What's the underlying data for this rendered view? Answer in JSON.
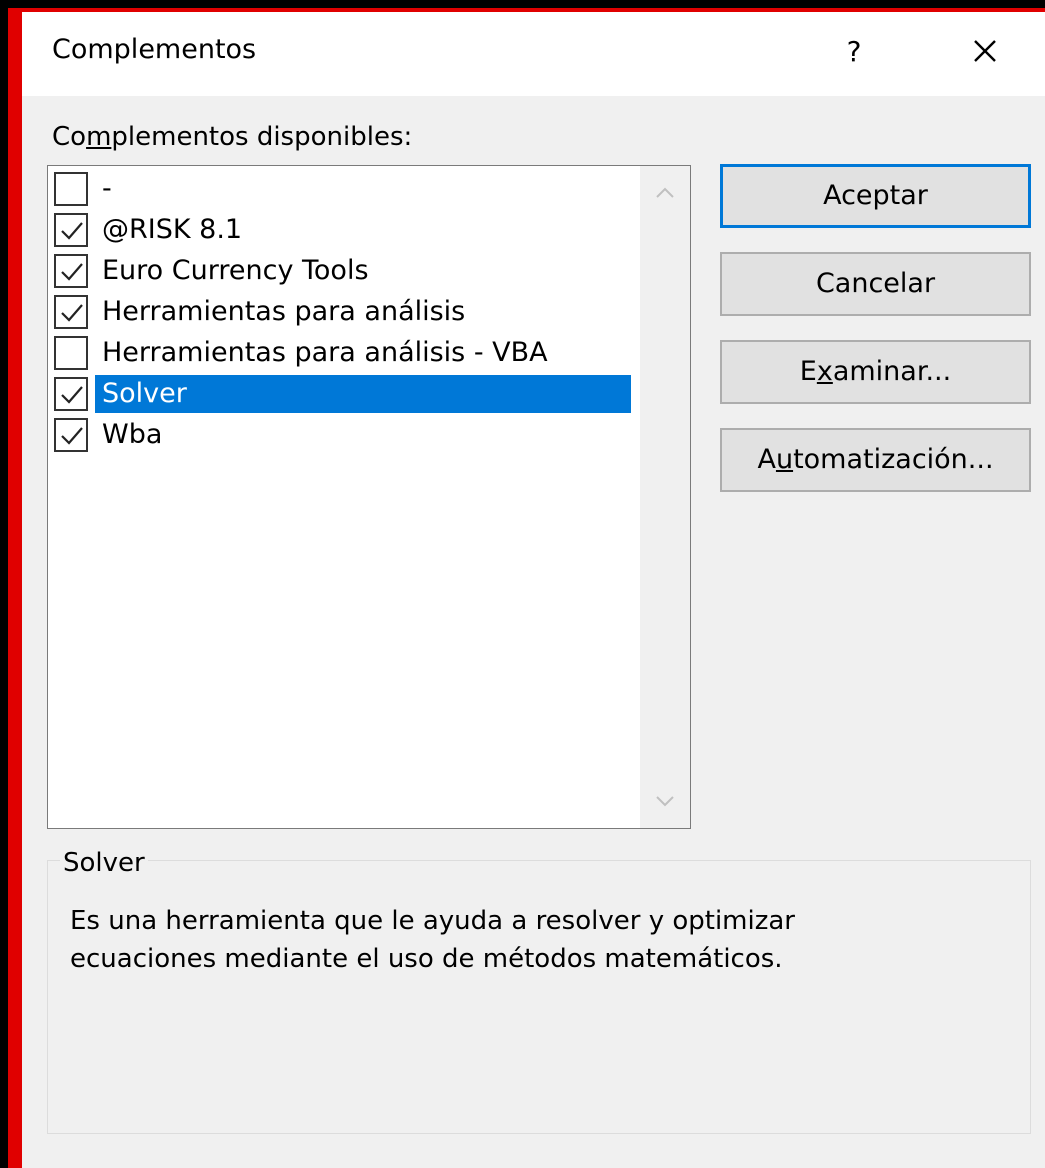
{
  "dialog": {
    "title": "Complementos",
    "help_label": "?",
    "close_icon": "close-icon"
  },
  "available": {
    "label_prefix": "Co",
    "label_underlined": "m",
    "label_suffix": "plementos disponibles:"
  },
  "addins": [
    {
      "label": "-",
      "checked": false,
      "selected": false
    },
    {
      "label": "@RISK 8.1",
      "checked": true,
      "selected": false
    },
    {
      "label": "Euro Currency Tools",
      "checked": true,
      "selected": false
    },
    {
      "label": "Herramientas para análisis",
      "checked": true,
      "selected": false
    },
    {
      "label": "Herramientas para análisis - VBA",
      "checked": false,
      "selected": false
    },
    {
      "label": "Solver",
      "checked": true,
      "selected": true
    },
    {
      "label": "Wba",
      "checked": true,
      "selected": false
    }
  ],
  "buttons": {
    "accept": "Aceptar",
    "cancel": "Cancelar",
    "browse_prefix": "E",
    "browse_underlined": "x",
    "browse_suffix": "aminar...",
    "automation_prefix": "A",
    "automation_underlined": "u",
    "automation_suffix": "tomatización..."
  },
  "details": {
    "title": "Solver",
    "description_line1": "Es una herramienta que le ayuda a resolver y optimizar",
    "description_line2": "ecuaciones mediante el uso de métodos matemáticos."
  },
  "colors": {
    "selection": "#0078d7",
    "frame_border": "#e00000",
    "dialog_bg": "#f0f0f0"
  }
}
